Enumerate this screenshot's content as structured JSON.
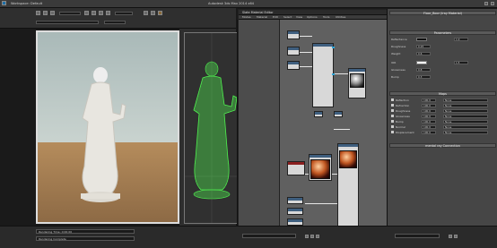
{
  "main_window": {
    "title": "Autodesk 3ds Max 2014 x64",
    "workspace": "Workspace: Default"
  },
  "material_editor": {
    "title": "Slate Material Editor",
    "menu": [
      "Modes",
      "Material",
      "Edit",
      "Select",
      "View",
      "Options",
      "Tools",
      "Utilities"
    ]
  },
  "command_panel": {
    "rollouts": [
      "Materials",
      "Standard",
      "Iray",
      "mental ray",
      "Scene Materials",
      "Sample Slots"
    ]
  },
  "material_params": {
    "header": "Floor_Boor (Iray Material)",
    "rollout_main": "Parameters",
    "rollout_maps": "Maps",
    "rollout_special": "mental ray Connection",
    "rows": [
      {
        "label": "Reflectance",
        "value": "1.0"
      },
      {
        "label": "Roughness",
        "value": "0.25"
      },
      {
        "label": "Weight",
        "value": "0.6"
      },
      {
        "label": "IOR",
        "value": "1.5"
      },
      {
        "label": "Glossiness",
        "value": "0.8"
      },
      {
        "label": "Bump",
        "value": "0.3"
      }
    ],
    "map_rows": [
      "Reflection",
      "Refraction",
      "Roughness",
      "Glossiness",
      "Bump",
      "Normal",
      "Displacement"
    ],
    "map_value": "100.0",
    "map_slot": "None"
  },
  "status_bar": {
    "field1": "Rendering Time: 0:00:00",
    "field2": "Rendering Complete"
  },
  "colors": {
    "accent": "#2fa5d8",
    "wire": "#e6e6e6",
    "node_header": "#3f5f7f"
  }
}
